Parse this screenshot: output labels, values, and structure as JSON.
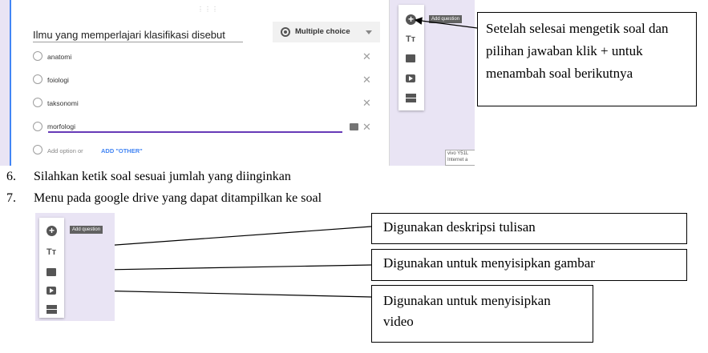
{
  "form": {
    "question": "Ilmu yang memperlajari klasifikasi disebut",
    "type_label": "Multiple choice",
    "options": [
      "anatomi",
      "foiologi",
      "taksonomi",
      "morfologi"
    ],
    "add_option": "Add option",
    "or": "or",
    "add_other": "ADD \"OTHER\"",
    "tooltip": "Add question",
    "watermark": "vivo Y51L Internet a"
  },
  "callout_top": "Setelah selesai mengetik soal dan pilihan jawaban klik + untuk menambah soal berikutnya",
  "steps": [
    {
      "num": "6.",
      "text": "Silahkan ketik soal sesuai jumlah yang diinginkan"
    },
    {
      "num": "7.",
      "text": "Menu pada google drive yang dapat ditampilkan ke soal"
    }
  ],
  "toolbar2": {
    "tooltip": "Add question"
  },
  "callouts": [
    "Digunakan deskripsi tulisan",
    "Digunakan untuk menyisipkan gambar",
    "Digunakan untuk menyisipkan video"
  ],
  "icons": {
    "add": "plus-circle-icon",
    "title": "title-text-icon",
    "image": "image-icon",
    "video": "video-icon",
    "section": "section-icon",
    "close": "close-icon"
  },
  "colors": {
    "accent": "#673ab7",
    "link": "#4285f4",
    "panel_bg": "#e9e4f4"
  }
}
